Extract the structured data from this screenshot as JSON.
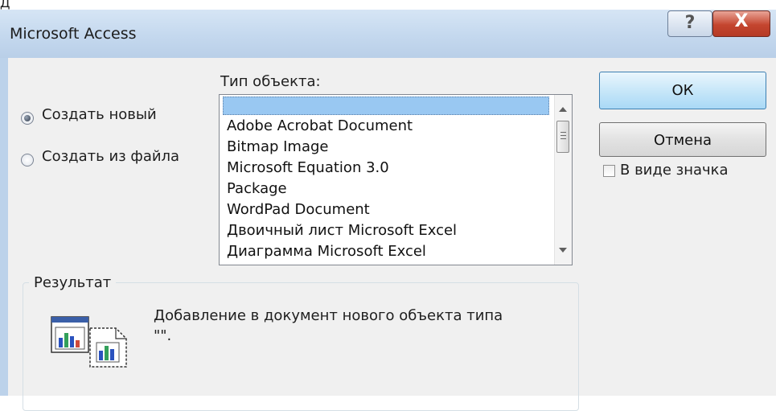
{
  "top_fragment": "Д",
  "window": {
    "title": "Microsoft Access",
    "help_label": "?",
    "close_label": "X"
  },
  "create_options": [
    {
      "label": "Создать новый",
      "checked": true
    },
    {
      "label": "Создать из файла",
      "checked": false
    }
  ],
  "object_type": {
    "label": "Тип объекта:",
    "items": [
      "",
      "Adobe Acrobat Document",
      "Bitmap Image",
      "Microsoft Equation 3.0",
      "Package",
      "WordPad Document",
      "Двоичный лист Microsoft Excel",
      "Диаграмма Microsoft Excel"
    ],
    "selected_index": 0
  },
  "buttons": {
    "ok": "ОК",
    "cancel": "Отмена"
  },
  "display_as_icon": {
    "label": "В виде значка",
    "checked": false
  },
  "result": {
    "legend": "Результат",
    "text": "Добавление в документ нового объекта типа",
    "text2": "\"\"."
  },
  "colors": {
    "selection": "#99c8f2",
    "ok_button": "#c8e7f9",
    "close_button": "#c4452f",
    "dialog_bg": "#f0f0f0"
  }
}
